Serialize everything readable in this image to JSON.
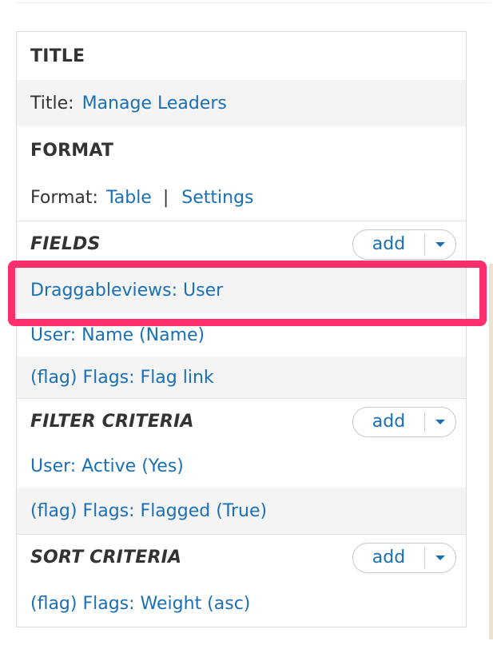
{
  "title_section": {
    "heading": "TITLE",
    "label": "Title:",
    "value": "Manage Leaders"
  },
  "format_section": {
    "heading": "FORMAT",
    "label": "Format:",
    "value": "Table",
    "separator": "|",
    "settings": "Settings"
  },
  "fields_section": {
    "heading": "FIELDS",
    "add_label": "add",
    "items": [
      "Draggableviews: User",
      "User: Name (Name)",
      "(flag) Flags: Flag link"
    ]
  },
  "filter_section": {
    "heading": "FILTER CRITERIA",
    "add_label": "add",
    "items": [
      "User: Active (Yes)",
      "(flag) Flags: Flagged (True)"
    ]
  },
  "sort_section": {
    "heading": "SORT CRITERIA",
    "add_label": "add",
    "items": [
      "(flag) Flags: Weight (asc)"
    ]
  },
  "colors": {
    "link": "#1a6fb5",
    "highlight": "#ff2f6d",
    "alt_row": "#f4f4f4"
  },
  "icons": {
    "dropdown": "chevron-down-icon"
  }
}
